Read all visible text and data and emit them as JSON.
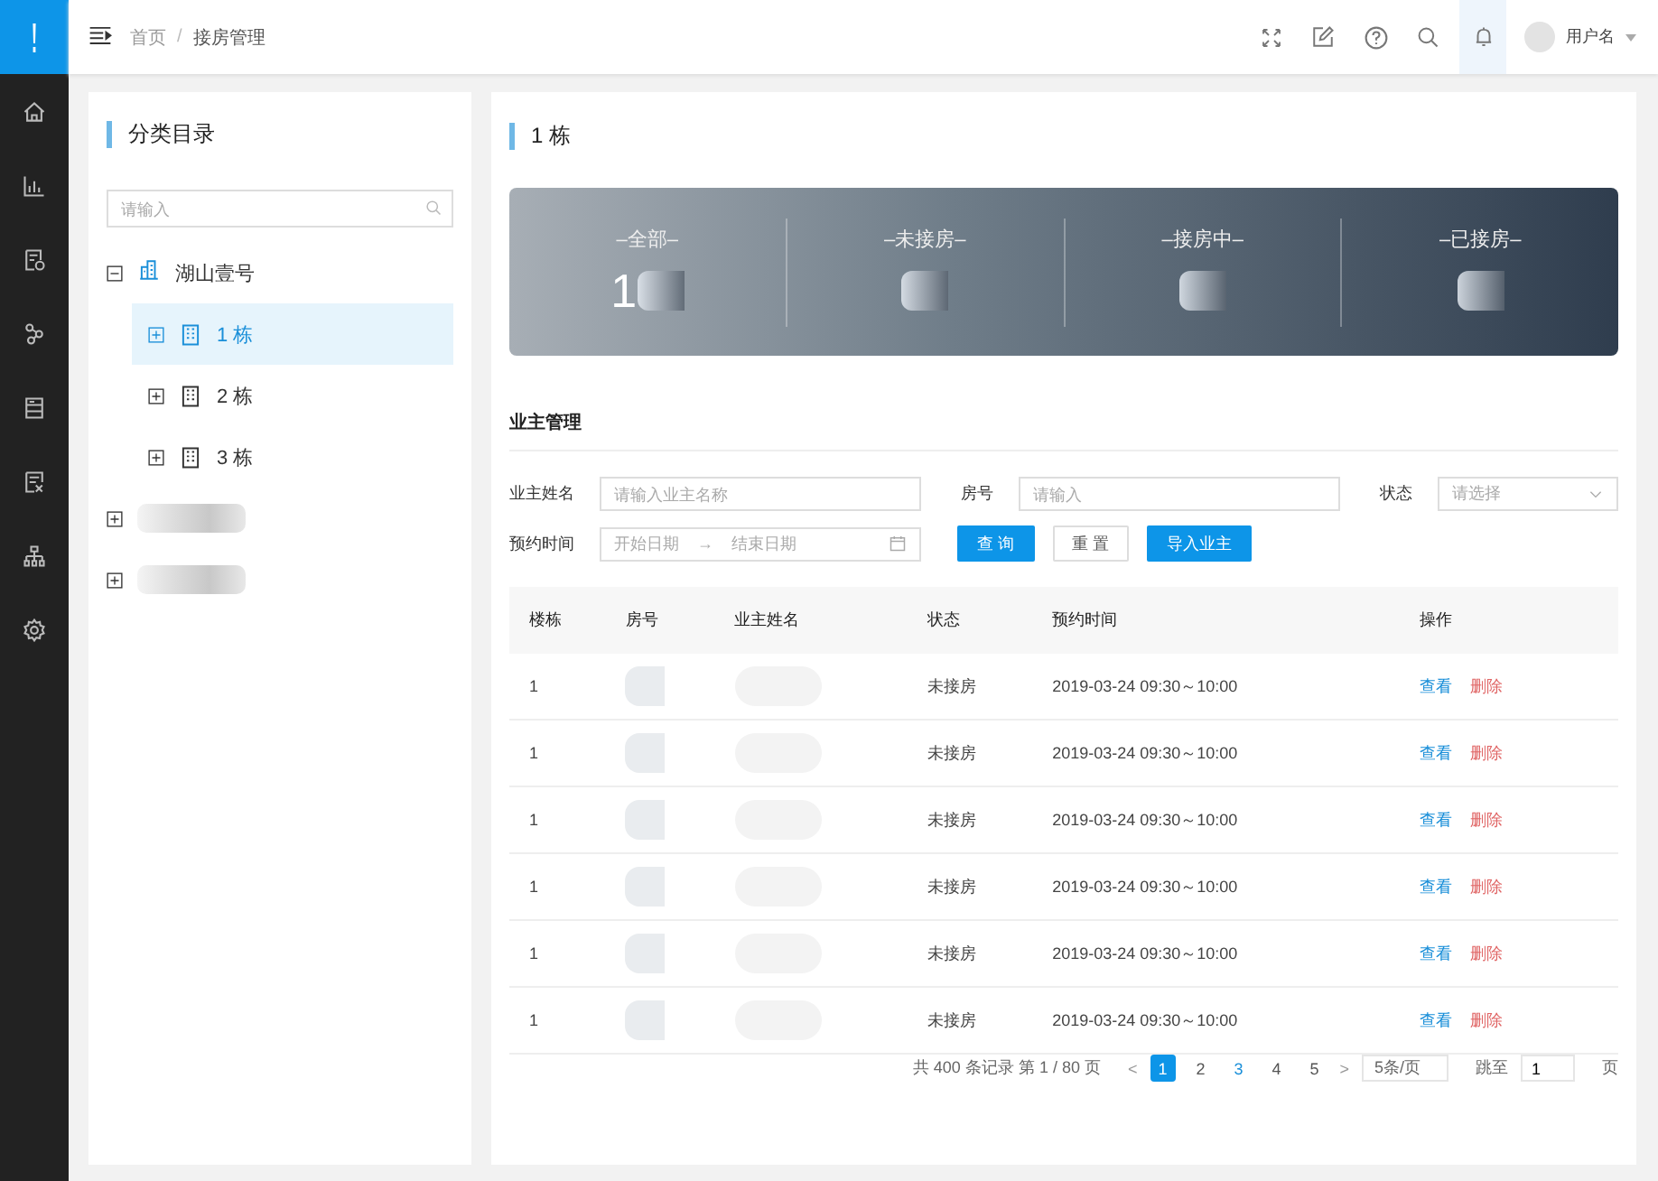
{
  "breadcrumb": [
    "首页",
    "接房管理"
  ],
  "breadcrumb_separator": "/",
  "user": {
    "name": "用户名"
  },
  "nav": [
    {
      "kind": "home",
      "selected": false
    },
    {
      "kind": "chart",
      "selected": false
    },
    {
      "kind": "doc",
      "selected": false
    },
    {
      "kind": "flow",
      "selected": false
    },
    {
      "kind": "list",
      "selected": false
    },
    {
      "kind": "form",
      "selected": false
    },
    {
      "kind": "org",
      "selected": false
    },
    {
      "kind": "gear",
      "selected": false
    }
  ],
  "category": {
    "title": "分类目录",
    "search": {
      "placeholder": "请输入"
    },
    "tree": [
      {
        "kind": "node",
        "label": "湖山壹号",
        "expanded": true,
        "selected": false,
        "children": [
          {
            "kind": "node",
            "label": "1 栋",
            "expanded": false,
            "selected": true
          },
          {
            "kind": "node",
            "label": "2 栋",
            "expanded": false,
            "selected": false
          },
          {
            "kind": "node",
            "label": "3 栋",
            "expanded": false,
            "selected": false
          }
        ]
      },
      {
        "kind": "redacted",
        "expanded": false
      },
      {
        "kind": "redacted",
        "expanded": false
      }
    ]
  },
  "main": {
    "title": "1 栋",
    "stats": [
      {
        "label": "–全部–",
        "value": "1"
      },
      {
        "label": "–未接房–"
      },
      {
        "label": "–接房中–"
      },
      {
        "label": "–已接房–"
      }
    ],
    "section": "业主管理",
    "filters": [
      {
        "label": "业主姓名",
        "placeholder": "请输入业主名称"
      },
      {
        "label": "房号",
        "placeholder": "请输入"
      },
      {
        "label": "状态",
        "placeholder": "请选择"
      }
    ],
    "date": {
      "label": "预约时间",
      "start": "开始日期",
      "arrow": "→",
      "end": "结束日期"
    },
    "buttons": [
      {
        "label": "查 询",
        "kind": "primary"
      },
      {
        "label": "重 置",
        "kind": "default"
      },
      {
        "label": "导入业主",
        "kind": "primary"
      }
    ],
    "table": {
      "columns": [
        "楼栋",
        "房号",
        "业主姓名",
        "状态",
        "预约时间",
        "操作"
      ],
      "rows": [
        {
          "building": "1",
          "status": "未接房",
          "time": "2019-03-24 09:30～10:00",
          "actions": [
            "查看",
            "删除"
          ]
        },
        {
          "building": "1",
          "status": "未接房",
          "time": "2019-03-24 09:30～10:00",
          "actions": [
            "查看",
            "删除"
          ]
        },
        {
          "building": "1",
          "status": "未接房",
          "time": "2019-03-24 09:30～10:00",
          "actions": [
            "查看",
            "删除"
          ]
        },
        {
          "building": "1",
          "status": "未接房",
          "time": "2019-03-24 09:30～10:00",
          "actions": [
            "查看",
            "删除"
          ]
        },
        {
          "building": "1",
          "status": "未接房",
          "time": "2019-03-24 09:30～10:00",
          "actions": [
            "查看",
            "删除"
          ]
        },
        {
          "building": "1",
          "status": "未接房",
          "time": "2019-03-24 09:30～10:00",
          "actions": [
            "查看",
            "删除"
          ]
        }
      ]
    },
    "pagination": {
      "total": "共 400 条记录 第 1 / 80 页",
      "prev": "<",
      "next": ">",
      "pages": [
        {
          "label": "1",
          "selected": true,
          "hovered": false
        },
        {
          "label": "2",
          "selected": false,
          "hovered": false
        },
        {
          "label": "3",
          "selected": false,
          "hovered": true
        },
        {
          "label": "4",
          "selected": false,
          "hovered": false
        },
        {
          "label": "5",
          "selected": false,
          "hovered": false
        }
      ],
      "size": "5条/页",
      "jump": "跳至",
      "jump_value": "1",
      "page_unit": "页"
    }
  }
}
